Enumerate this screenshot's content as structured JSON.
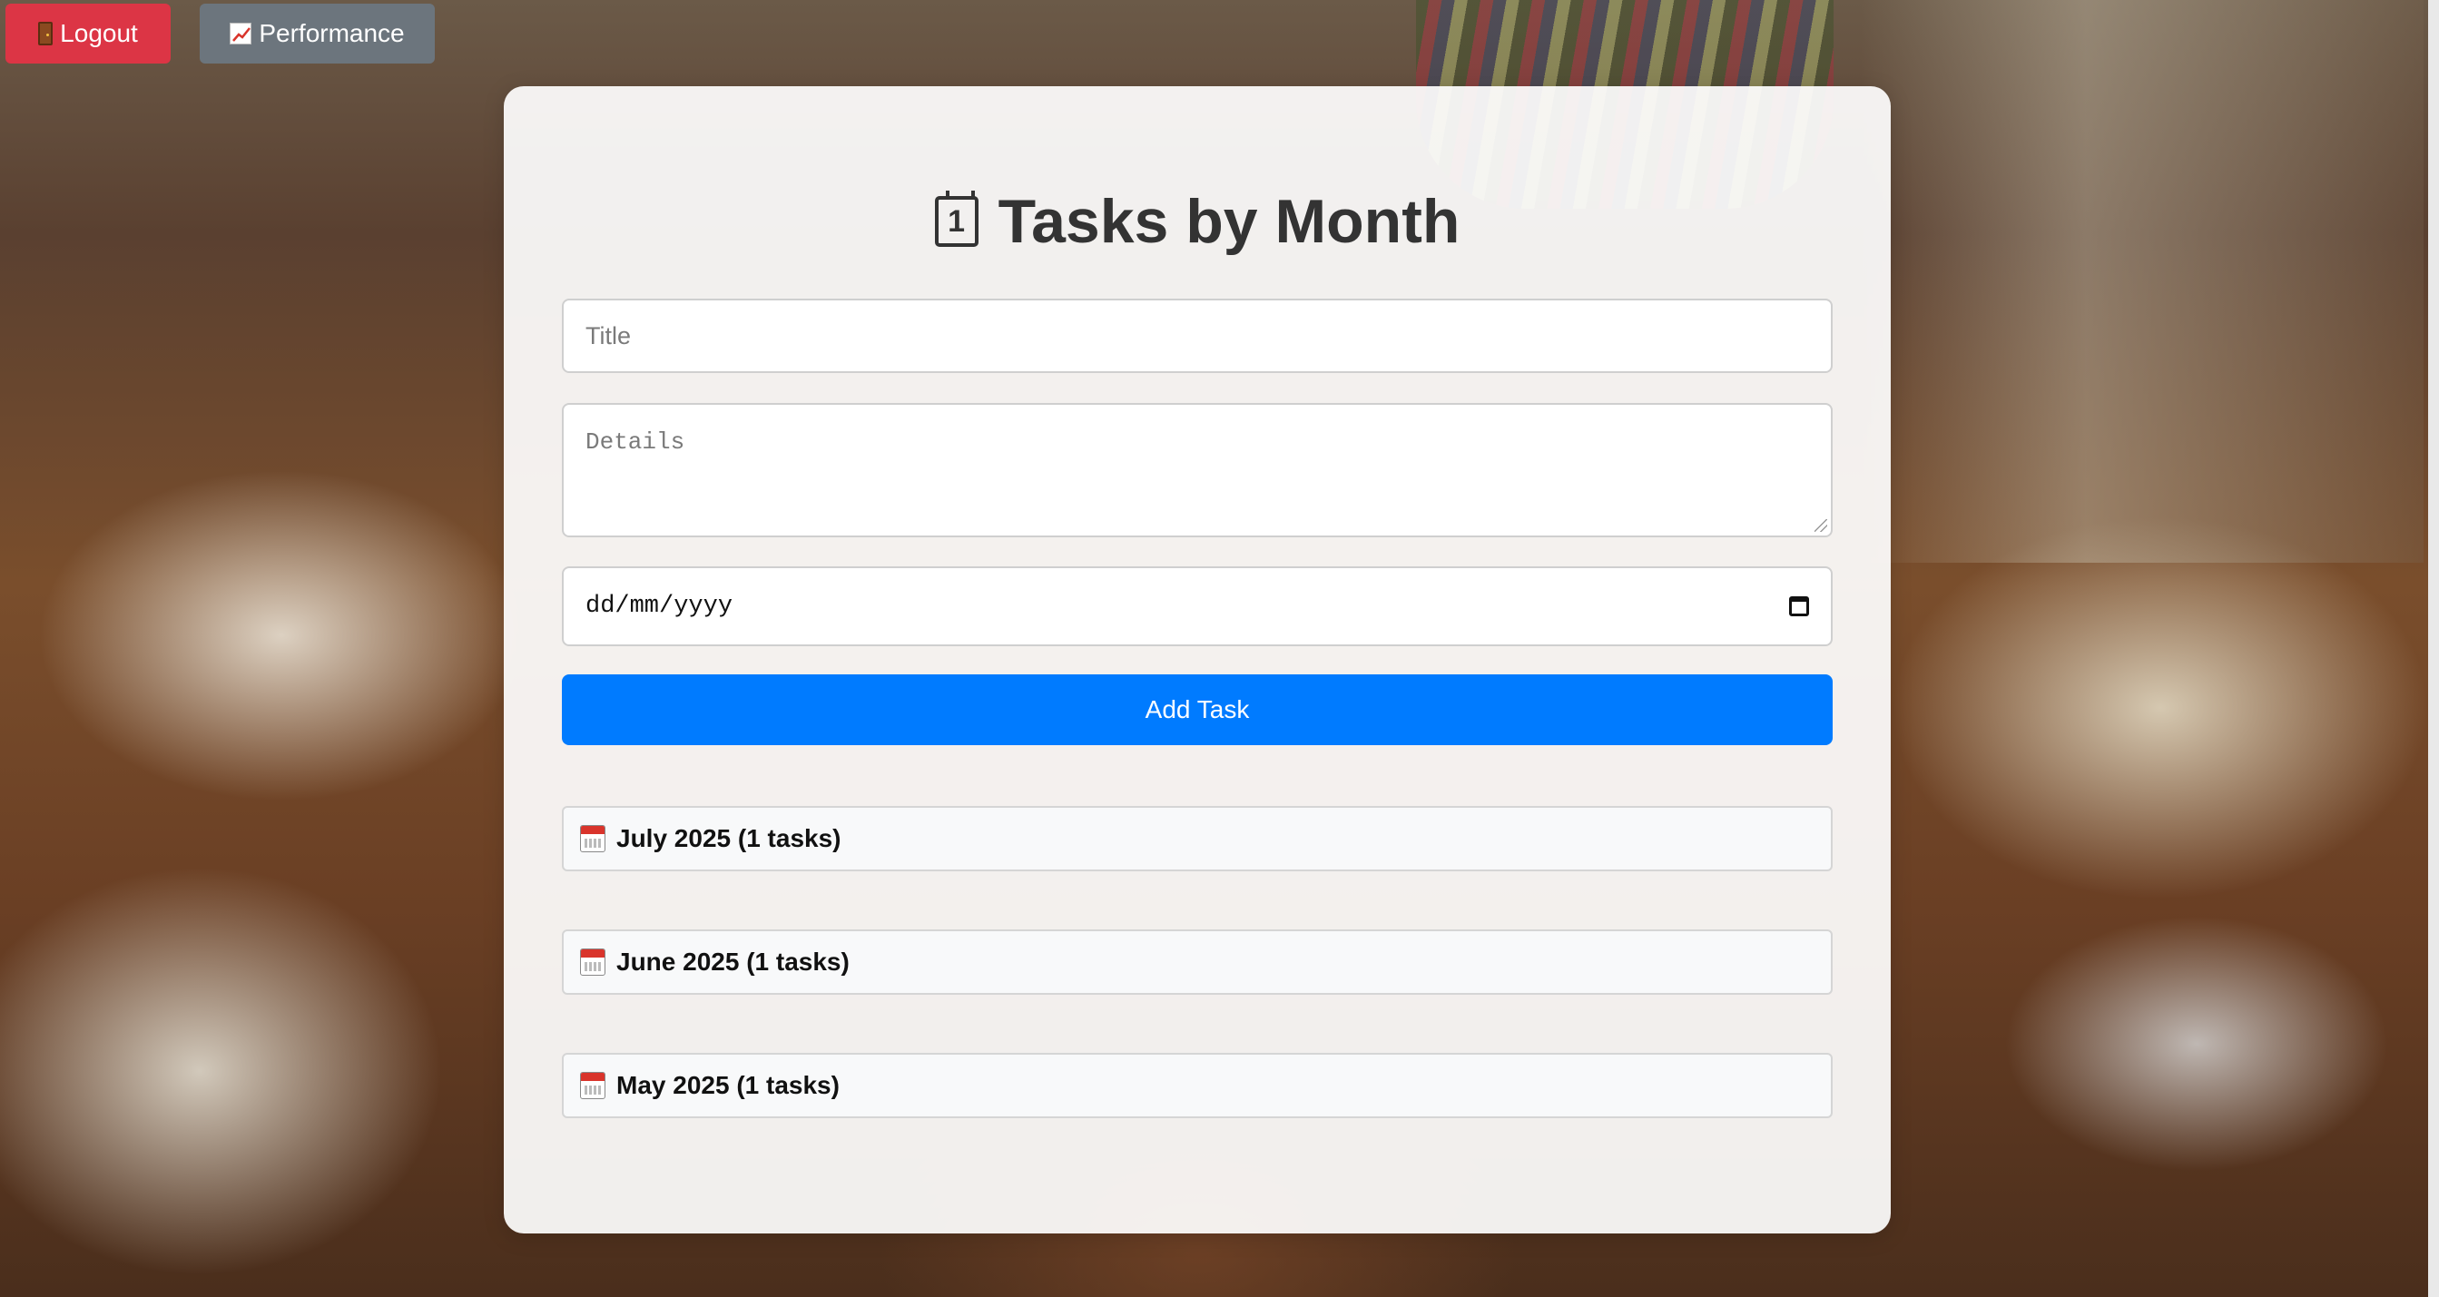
{
  "nav": {
    "logout_label": "Logout",
    "logout_icon": "door-icon",
    "performance_label": "Performance",
    "performance_icon": "chart-increasing-icon"
  },
  "card": {
    "title": "Tasks by Month",
    "title_icon": "calendar-icon",
    "title_icon_digit": "1",
    "form": {
      "title_placeholder": "Title",
      "details_placeholder": "Details",
      "date_placeholder": "dd/mm/yyyy",
      "add_button_label": "Add Task"
    },
    "months": [
      {
        "label": "July 2025 (1 tasks)"
      },
      {
        "label": "June 2025 (1 tasks)"
      },
      {
        "label": "May 2025 (1 tasks)"
      }
    ]
  },
  "colors": {
    "logout": "#dc3545",
    "performance": "#6c757d",
    "primary": "#007bff"
  }
}
